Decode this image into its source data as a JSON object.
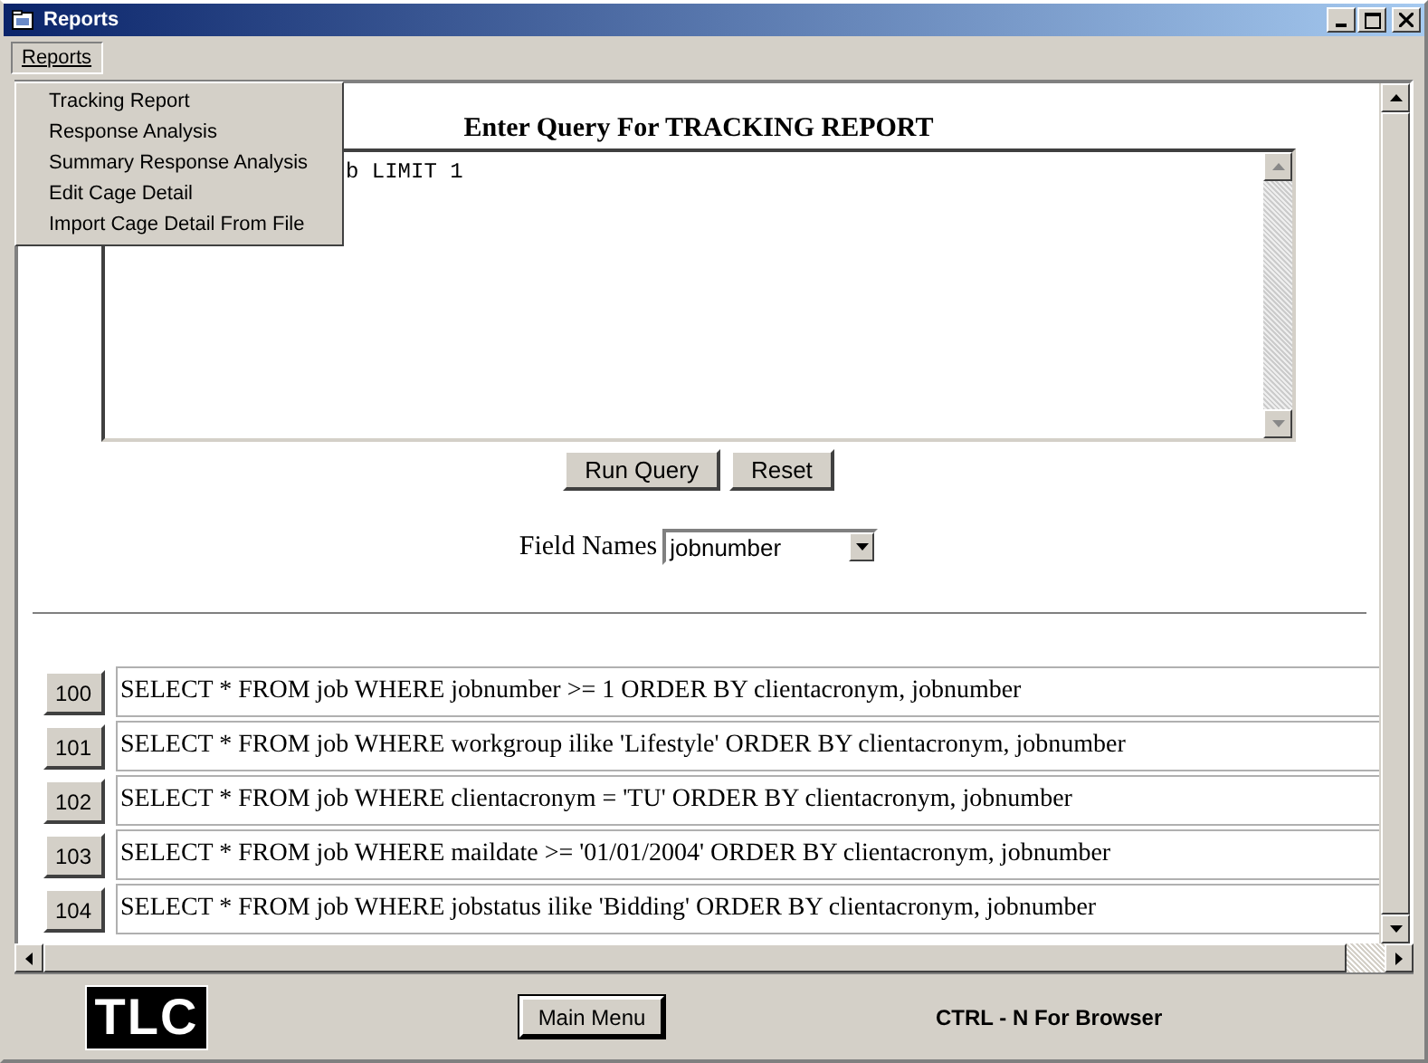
{
  "window": {
    "title": "Reports"
  },
  "menubar": [
    {
      "label": "Reports",
      "selected": true
    }
  ],
  "menu": {
    "items": [
      {
        "label": "Tracking Report"
      },
      {
        "label": "Response Analysis"
      },
      {
        "label": "Summary Response Analysis"
      },
      {
        "label": "Edit Cage Detail"
      },
      {
        "label": "Import Cage Detail From File"
      }
    ]
  },
  "query": {
    "heading": "Enter Query For TRACKING REPORT",
    "value": "b LIMIT 1"
  },
  "buttons": [
    "Run Query",
    "Reset"
  ],
  "field_names": {
    "label": "Field Names",
    "value": "jobnumber"
  },
  "saved_queries": [
    {
      "id": "100",
      "sql": "SELECT * FROM job WHERE jobnumber >= 1 ORDER BY clientacronym, jobnumber"
    },
    {
      "id": "101",
      "sql": "SELECT * FROM job WHERE workgroup ilike 'Lifestyle' ORDER BY clientacronym, jobnumber"
    },
    {
      "id": "102",
      "sql": "SELECT * FROM job WHERE clientacronym = 'TU' ORDER BY clientacronym, jobnumber"
    },
    {
      "id": "103",
      "sql": "SELECT * FROM job WHERE maildate >= '01/01/2004' ORDER BY clientacronym, jobnumber"
    },
    {
      "id": "104",
      "sql": "SELECT * FROM job WHERE jobstatus ilike 'Bidding' ORDER BY clientacronym, jobnumber"
    }
  ],
  "footer": {
    "logo": "TLC",
    "main_menu": "Main Menu",
    "hint": "CTRL - N For Browser"
  }
}
